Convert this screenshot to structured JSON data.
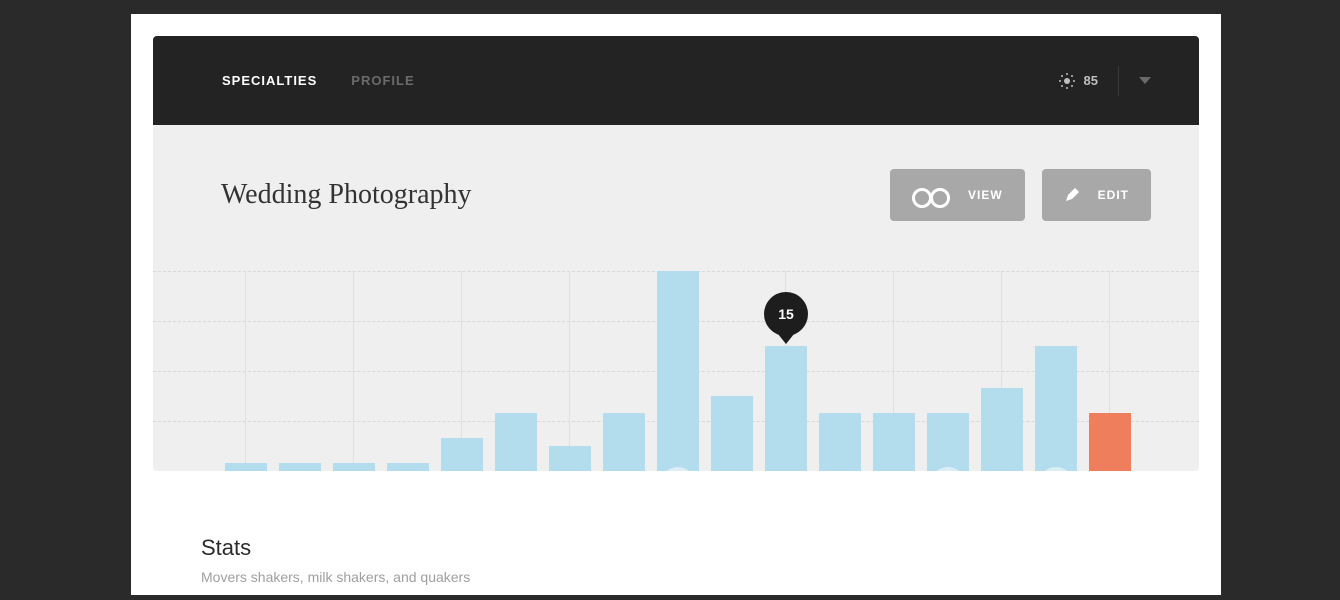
{
  "header": {
    "nav": [
      {
        "label": "SPECIALTIES",
        "active": true
      },
      {
        "label": "PROFILE",
        "active": false
      }
    ],
    "temperature": "85"
  },
  "page": {
    "title": "Wedding Photography",
    "view_label": "VIEW",
    "edit_label": "EDIT"
  },
  "tooltip_value": "15",
  "chart_data": {
    "type": "bar",
    "title": "",
    "xlabel": "",
    "ylabel": "",
    "ylim": [
      0,
      24
    ],
    "values": [
      1,
      1,
      1,
      1,
      4,
      7,
      3,
      7,
      24,
      9,
      15,
      7,
      7,
      7,
      10,
      15,
      7
    ],
    "highlight_index": 16,
    "tooltip_index": 10,
    "tooltip_value": 15,
    "below_icons": {
      "8": "thumbs-up",
      "13": "bird",
      "15": "pencil"
    }
  },
  "stats": {
    "heading": "Stats",
    "sub": "Movers shakers, milk shakers, and quakers"
  }
}
